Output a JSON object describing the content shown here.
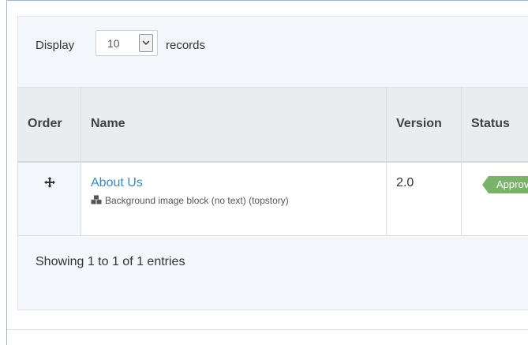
{
  "length_control": {
    "prefix": "Display",
    "selected": "10",
    "suffix": "records"
  },
  "table": {
    "columns": [
      "Order",
      "Name",
      "Version",
      "Status"
    ],
    "rows": [
      {
        "name": "About Us",
        "subtitle": "Background image block (no text) (topstory)",
        "version": "2.0",
        "status": "Approved"
      }
    ]
  },
  "info": "Showing 1 to 1 of 1 entries",
  "colors": {
    "link": "#3a87c8",
    "status_approved": "#7ab26a",
    "header_bg": "#e9edf0",
    "panel_bg": "#f3f6fb"
  },
  "icons": {
    "order_handle": "move-arrows-icon",
    "block_type": "cubes-icon",
    "select_toggle": "chevron-down-icon"
  }
}
